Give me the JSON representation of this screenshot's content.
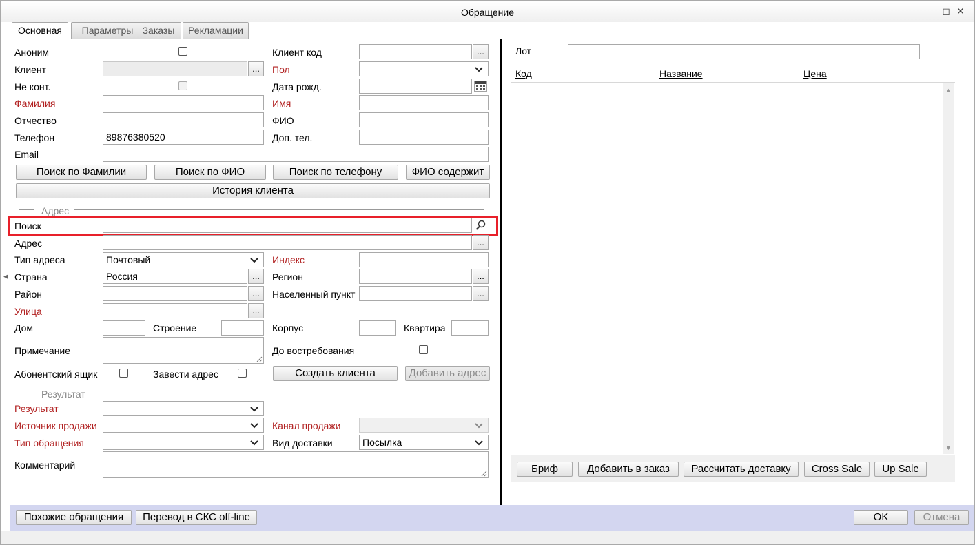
{
  "window": {
    "title": "Обращение"
  },
  "tabs": [
    "Основная",
    "Параметры",
    "Заказы",
    "Рекламации"
  ],
  "client": {
    "anon_label": "Аноним",
    "client_label": "Клиент",
    "no_contact_label": "Не конт.",
    "lastname_label": "Фамилия",
    "middlename_label": "Отчество",
    "phone_label": "Телефон",
    "phone_value": "89876380520",
    "email_label": "Email",
    "client_code_label": "Клиент код",
    "gender_label": "Пол",
    "birthdate_label": "Дата рожд.",
    "firstname_label": "Имя",
    "fio_label": "ФИО",
    "extra_phone_label": "Доп. тел."
  },
  "search_buttons": {
    "by_lastname": "Поиск по Фамилии",
    "by_fio": "Поиск по ФИО",
    "by_phone": "Поиск по телефону",
    "fio_contains": "ФИО содержит",
    "history": "История клиента"
  },
  "address": {
    "section_label": "Адрес",
    "search_label": "Поиск",
    "address_label": "Адрес",
    "type_label": "Тип адреса",
    "type_value": "Почтовый",
    "index_label": "Индекс",
    "country_label": "Страна",
    "country_value": "Россия",
    "region_label": "Регион",
    "district_label": "Район",
    "locality_label": "Населенный пункт",
    "street_label": "Улица",
    "house_label": "Дом",
    "building_label": "Строение",
    "corpus_label": "Корпус",
    "apartment_label": "Квартира",
    "note_label": "Примечание",
    "on_demand_label": "До востребования",
    "po_box_label": "Абонентский ящик",
    "create_address_label": "Завести адрес",
    "create_client_btn": "Создать клиента",
    "add_address_btn": "Добавить адрес"
  },
  "result": {
    "section_label": "Результат",
    "result_label": "Результат",
    "sale_source_label": "Источник продажи",
    "sale_channel_label": "Канал продажи",
    "request_type_label": "Тип обращения",
    "delivery_type_label": "Вид доставки",
    "delivery_type_value": "Посылка",
    "comment_label": "Комментарий"
  },
  "right": {
    "lot_label": "Лот",
    "columns": [
      "Код",
      "Название",
      "Цена"
    ],
    "buttons": [
      "Бриф",
      "Добавить в заказ",
      "Рассчитать доставку",
      "Cross Sale",
      "Up Sale"
    ]
  },
  "footer": {
    "similar": "Похожие обращения",
    "transfer": "Перевод в СКС off-line",
    "ok": "OK",
    "cancel": "Отмена"
  }
}
